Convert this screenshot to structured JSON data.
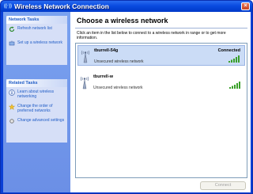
{
  "window": {
    "title": "Wireless Network Connection",
    "close_glyph": "×"
  },
  "sidebar": {
    "network_tasks": {
      "header": "Network Tasks",
      "items": [
        {
          "label": "Refresh network list",
          "icon": "refresh-icon"
        },
        {
          "label": "Set up a wireless network",
          "icon": "setup-wireless-icon"
        }
      ]
    },
    "related_tasks": {
      "header": "Related Tasks",
      "items": [
        {
          "label": "Learn about wireless networking",
          "icon": "info-icon"
        },
        {
          "label": "Change the order of preferred networks",
          "icon": "star-icon"
        },
        {
          "label": "Change advanced settings",
          "icon": "settings-icon"
        }
      ]
    }
  },
  "main": {
    "heading": "Choose a wireless network",
    "description": "Click an item in the list below to connect to a wireless network in range or to get more information.",
    "networks": [
      {
        "ssid": "tburrell-54g",
        "status": "Connected",
        "security": "Unsecured wireless network",
        "signal_bars": 5,
        "selected": true
      },
      {
        "ssid": "tburrell-w",
        "status": "",
        "security": "Unsecured wireless network",
        "signal_bars": 5,
        "selected": false
      }
    ],
    "connect_label": "Connect"
  },
  "colors": {
    "accent": "#215dc6",
    "signal_green": "#3aa02a",
    "selection": "#cbdcf6"
  }
}
